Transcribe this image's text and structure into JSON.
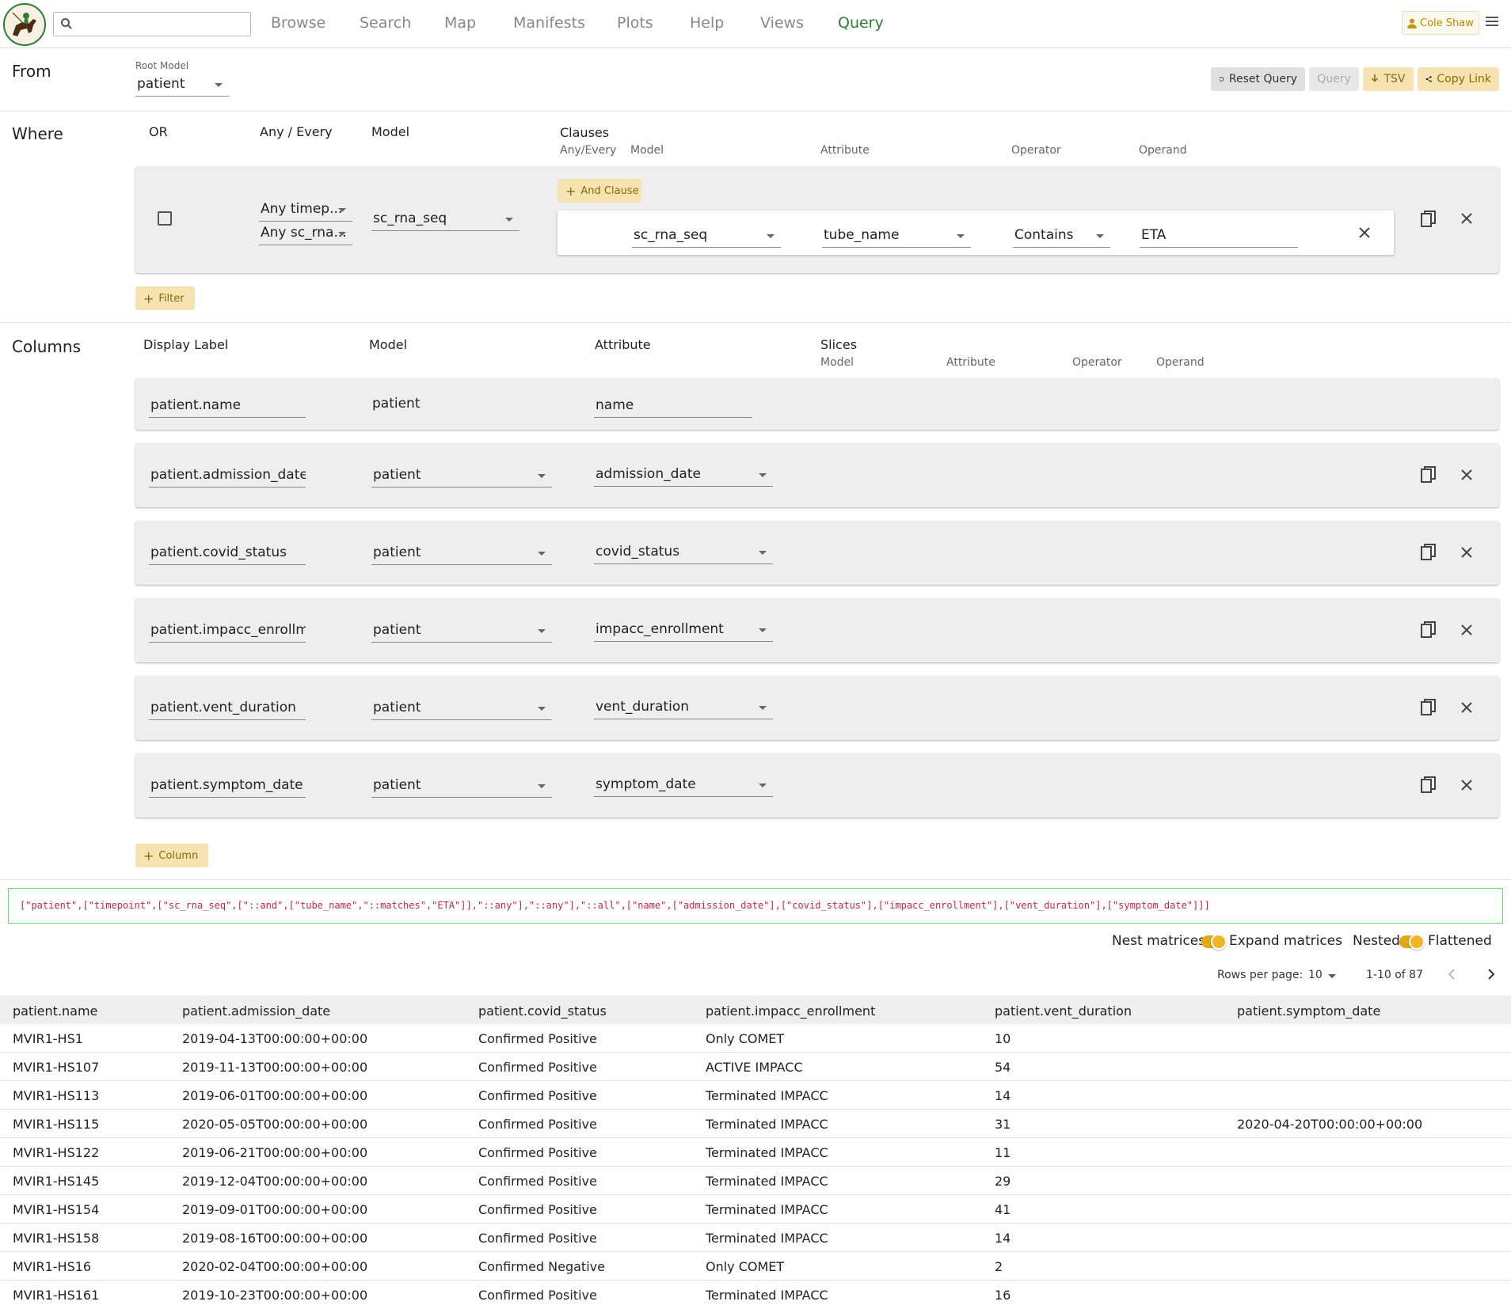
{
  "header": {
    "search_placeholder": "",
    "nav": [
      "Browse",
      "Search",
      "Map",
      "Manifests",
      "Plots",
      "Help",
      "Views",
      "Query"
    ],
    "active_nav": "Query",
    "user_name": "Cole Shaw"
  },
  "from": {
    "title": "From",
    "root_model_label": "Root Model",
    "root_model_value": "patient",
    "buttons": {
      "reset": "Reset Query",
      "query": "Query",
      "tsv": "TSV",
      "copy_link": "Copy Link"
    }
  },
  "where": {
    "title": "Where",
    "headers": {
      "or": "OR",
      "any_every": "Any / Every",
      "model": "Model",
      "clauses": "Clauses"
    },
    "clause_subheaders": {
      "any_every": "Any/Every",
      "model": "Model",
      "attribute": "Attribute",
      "operator": "Operator",
      "operand": "Operand"
    },
    "filter": {
      "any_every_1": "Any timep...",
      "any_every_2": "Any sc_rna...",
      "model": "sc_rna_seq",
      "and_clause_label": "And Clause",
      "clause": {
        "model": "sc_rna_seq",
        "attribute": "tube_name",
        "operator": "Contains",
        "operand": "ETA"
      }
    },
    "add_filter_label": "Filter"
  },
  "columns": {
    "title": "Columns",
    "headers": {
      "display_label": "Display Label",
      "model": "Model",
      "attribute": "Attribute",
      "slices": "Slices"
    },
    "slice_subheaders": {
      "model": "Model",
      "attribute": "Attribute",
      "operator": "Operator",
      "operand": "Operand"
    },
    "rows": [
      {
        "label": "patient.name",
        "model": "patient",
        "attribute": "name"
      },
      {
        "label": "patient.admission_date",
        "model": "patient",
        "attribute": "admission_date"
      },
      {
        "label": "patient.covid_status",
        "model": "patient",
        "attribute": "covid_status"
      },
      {
        "label": "patient.impacc_enrollment",
        "model": "patient",
        "attribute": "impacc_enrollment"
      },
      {
        "label": "patient.vent_duration",
        "model": "patient",
        "attribute": "vent_duration"
      },
      {
        "label": "patient.symptom_date",
        "model": "patient",
        "attribute": "symptom_date"
      }
    ],
    "add_column_label": "Column"
  },
  "query_string": "[\"patient\",[\"timepoint\",[\"sc_rna_seq\",[\"::and\",[\"tube_name\",\"::matches\",\"ETA\"]],\"::any\"],\"::any\"],\"::all\",[\"name\",[\"admission_date\"],[\"covid_status\"],[\"impacc_enrollment\"],[\"vent_duration\"],[\"symptom_date\"]]]",
  "options": {
    "nest_matrices": "Nest matrices",
    "expand_matrices": "Expand matrices",
    "nested": "Nested",
    "flattened": "Flattened"
  },
  "pagination": {
    "rows_per_page_label": "Rows per page:",
    "rows_per_page": "10",
    "range": "1-10 of 87"
  },
  "results": {
    "columns": [
      "patient.name",
      "patient.admission_date",
      "patient.covid_status",
      "patient.impacc_enrollment",
      "patient.vent_duration",
      "patient.symptom_date"
    ],
    "rows": [
      [
        "MVIR1-HS1",
        "2019-04-13T00:00:00+00:00",
        "Confirmed Positive",
        "Only COMET",
        "10",
        ""
      ],
      [
        "MVIR1-HS107",
        "2019-11-13T00:00:00+00:00",
        "Confirmed Positive",
        "ACTIVE IMPACC",
        "54",
        ""
      ],
      [
        "MVIR1-HS113",
        "2019-06-01T00:00:00+00:00",
        "Confirmed Positive",
        "Terminated IMPACC",
        "14",
        ""
      ],
      [
        "MVIR1-HS115",
        "2020-05-05T00:00:00+00:00",
        "Confirmed Positive",
        "Terminated IMPACC",
        "31",
        "2020-04-20T00:00:00+00:00"
      ],
      [
        "MVIR1-HS122",
        "2019-06-21T00:00:00+00:00",
        "Confirmed Positive",
        "Terminated IMPACC",
        "11",
        ""
      ],
      [
        "MVIR1-HS145",
        "2019-12-04T00:00:00+00:00",
        "Confirmed Positive",
        "Terminated IMPACC",
        "29",
        ""
      ],
      [
        "MVIR1-HS154",
        "2019-09-01T00:00:00+00:00",
        "Confirmed Positive",
        "Terminated IMPACC",
        "41",
        ""
      ],
      [
        "MVIR1-HS158",
        "2019-08-16T00:00:00+00:00",
        "Confirmed Positive",
        "Terminated IMPACC",
        "14",
        ""
      ],
      [
        "MVIR1-HS16",
        "2020-02-04T00:00:00+00:00",
        "Confirmed Negative",
        "Only COMET",
        "2",
        ""
      ],
      [
        "MVIR1-HS161",
        "2019-10-23T00:00:00+00:00",
        "Confirmed Positive",
        "Terminated IMPACC",
        "16",
        ""
      ]
    ]
  },
  "colors": {
    "accent_green": "#2e7d32",
    "gold": "#f5e3b2",
    "query_border": "#6ddc6d"
  }
}
